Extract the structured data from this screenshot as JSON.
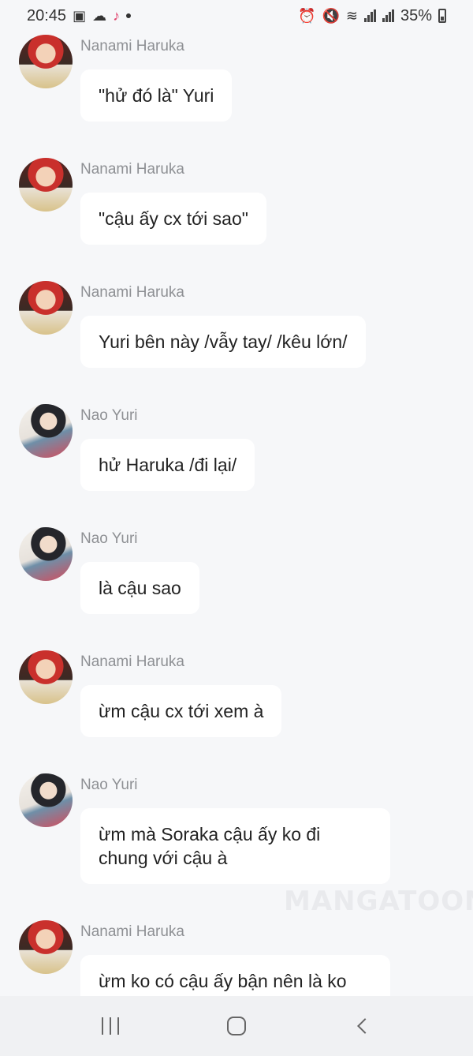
{
  "status_bar": {
    "time": "20:45",
    "battery": "35%"
  },
  "messages": [
    {
      "sender": "Nanami Haruka",
      "text": "\"hử đó là\" Yuri"
    },
    {
      "sender": "Nanami Haruka",
      "text": "\"cậu ấy cx tới sao\""
    },
    {
      "sender": "Nanami Haruka",
      "text": "Yuri bên này /vẫy tay/ /kêu lớn/"
    },
    {
      "sender": "Nao Yuri",
      "text": "hử Haruka /đi lại/"
    },
    {
      "sender": "Nao Yuri",
      "text": "là cậu sao"
    },
    {
      "sender": "Nanami Haruka",
      "text": "ừm cậu cx tới xem à"
    },
    {
      "sender": "Nao Yuri",
      "text": "ừm mà Soraka cậu ấy ko đi chung với cậu à"
    },
    {
      "sender": "Nanami Haruka",
      "text": "ừm ko có cậu ấy bận nên là ko"
    }
  ],
  "watermark": "MANGATOON",
  "icons": {
    "gallery": "image-icon",
    "cloud": "cloud-icon",
    "tiktok": "tiktok-icon",
    "alarm": "alarm-icon",
    "mute": "mute-icon",
    "wifi": "wifi-icon",
    "signal": "signal-icon",
    "battery": "battery-icon"
  }
}
